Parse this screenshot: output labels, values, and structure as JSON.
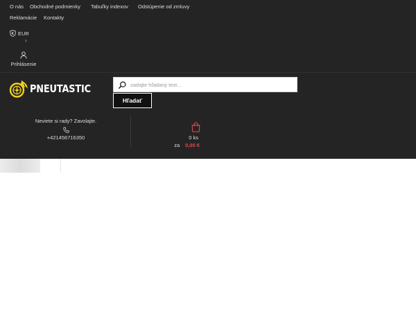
{
  "topnav": {
    "items": [
      {
        "label": "O nás"
      },
      {
        "label": "Obchodné podmienky"
      },
      {
        "label": "Tabuľky indexov"
      },
      {
        "label": "Odstúpenie od zmluvy"
      },
      {
        "label": "Reklamácie"
      },
      {
        "label": "Kontakty"
      }
    ]
  },
  "currency": {
    "label": "EUR",
    "icon": "shield-euro-icon",
    "caret": "›"
  },
  "login": {
    "label": "Prihlásenie",
    "icon": "user-icon"
  },
  "logo": {
    "text": "PNEUTASTIC",
    "icon": "tire-flame-icon",
    "accent": "#f2d21c"
  },
  "search": {
    "placeholder": "zadajte hľadaný text...",
    "value": "",
    "button_label": "Hľadať",
    "icon": "search-icon"
  },
  "contact": {
    "prompt": "Neviete si rady? Zavolajte.",
    "phone": "+421456716350",
    "icon": "phone-icon"
  },
  "cart": {
    "count": "0 ks",
    "total_prefix": "za",
    "total": "0,00 €",
    "icon": "shopping-bag-icon",
    "accent": "#e84848"
  },
  "colors": {
    "header_bg": "#242424",
    "text": "#dedede",
    "price": "#e84848"
  }
}
